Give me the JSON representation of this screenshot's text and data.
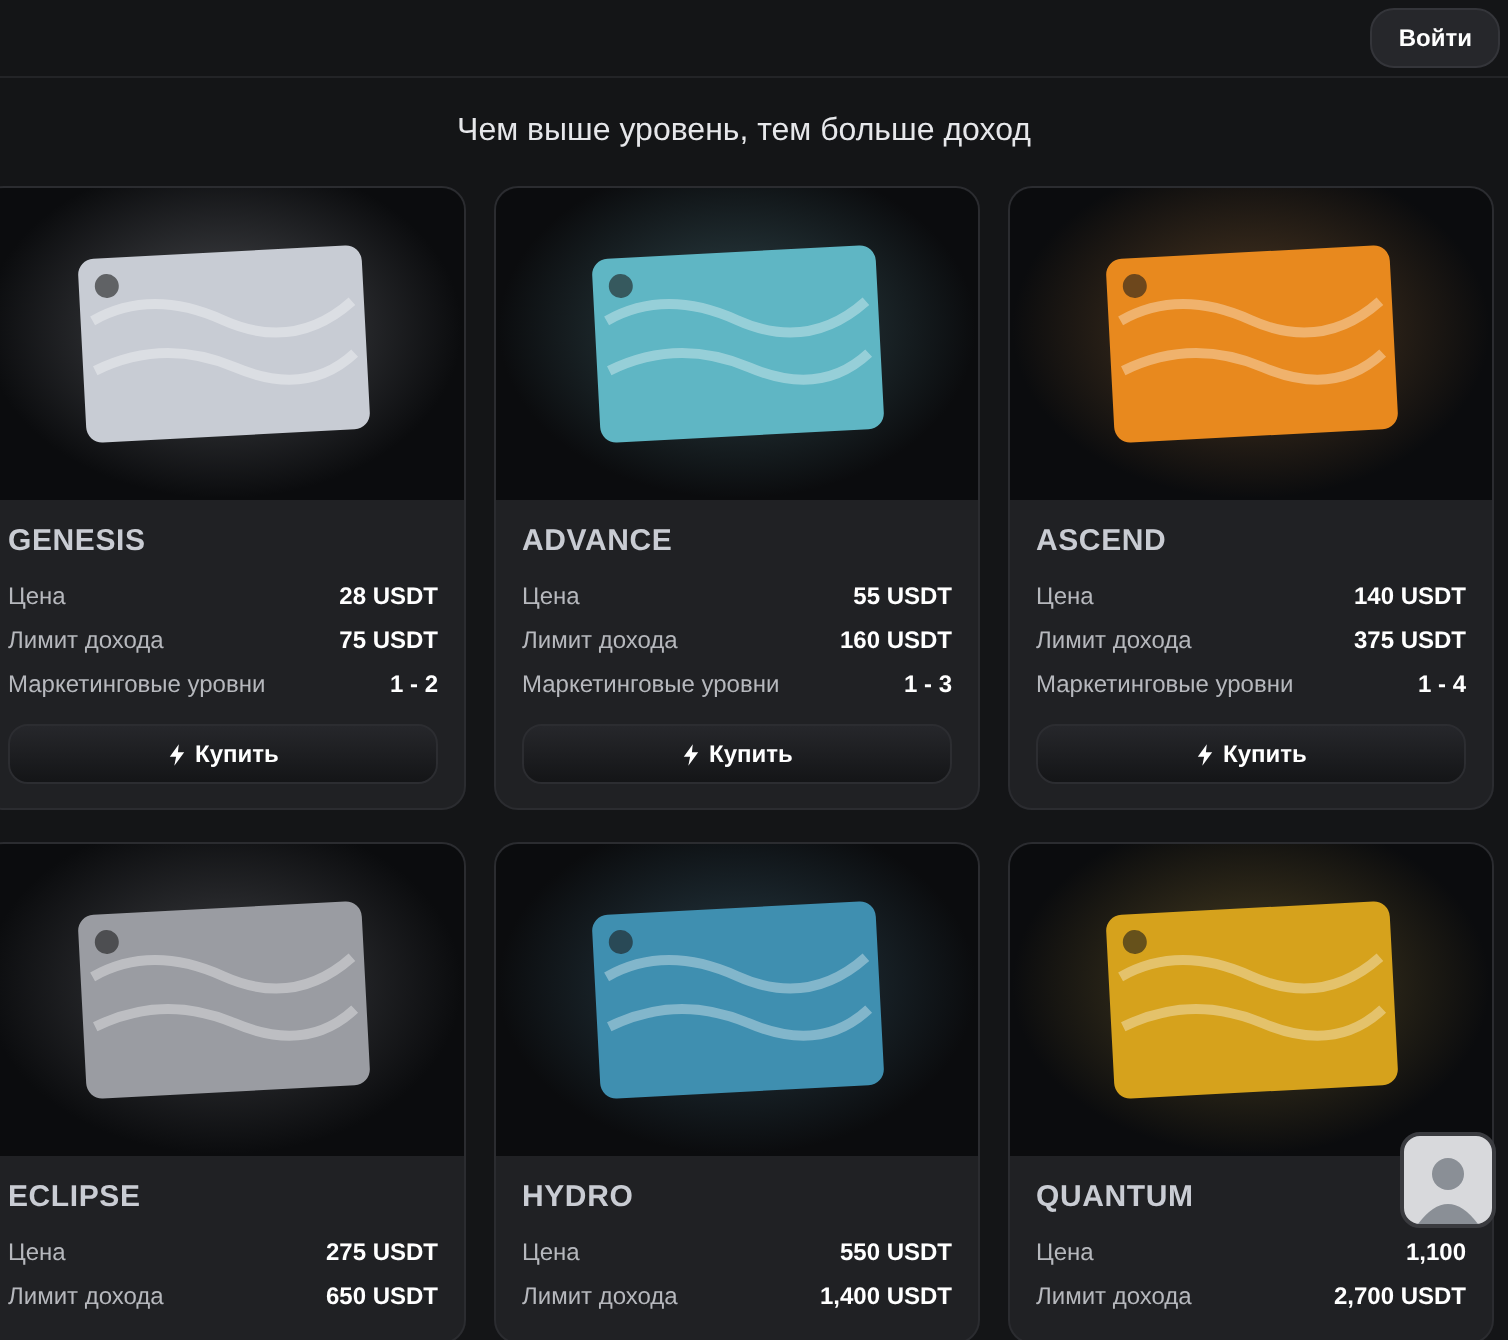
{
  "header": {
    "login_button": "Войти"
  },
  "heading": "Чем выше уровень, тем больше доход",
  "plans": [
    {
      "name": "GENESIS",
      "color": "#c8ccd4",
      "rows": [
        {
          "label": "Цена",
          "value": "28 USDT"
        },
        {
          "label": "Лимит дохода",
          "value": "75 USDT"
        },
        {
          "label": "Маркетинговые уровни",
          "value": "1 - 2"
        }
      ],
      "buy_button": "Купить"
    },
    {
      "name": "ADVANCE",
      "color": "#5fb6c4",
      "rows": [
        {
          "label": "Цена",
          "value": "55 USDT"
        },
        {
          "label": "Лимит дохода",
          "value": "160 USDT"
        },
        {
          "label": "Маркетинговые уровни",
          "value": "1 - 3"
        }
      ],
      "buy_button": "Купить"
    },
    {
      "name": "ASCEND",
      "color": "#e8891e",
      "rows": [
        {
          "label": "Цена",
          "value": "140 USDT"
        },
        {
          "label": "Лимит дохода",
          "value": "375 USDT"
        },
        {
          "label": "Маркетинговые уровни",
          "value": "1 - 4"
        }
      ],
      "buy_button": "Купить"
    },
    {
      "name": "ECLIPSE",
      "color": "#9a9ca2",
      "rows": [
        {
          "label": "Цена",
          "value": "275 USDT"
        },
        {
          "label": "Лимит дохода",
          "value": "650 USDT"
        }
      ]
    },
    {
      "name": "HYDRO",
      "color": "#3f8fb0",
      "rows": [
        {
          "label": "Цена",
          "value": "550 USDT"
        },
        {
          "label": "Лимит дохода",
          "value": "1,400 USDT"
        }
      ]
    },
    {
      "name": "QUANTUM",
      "color": "#d6a21c",
      "rows": [
        {
          "label": "Цена",
          "value": "1,100"
        },
        {
          "label": "Лимит дохода",
          "value": "2,700 USDT"
        }
      ]
    }
  ]
}
